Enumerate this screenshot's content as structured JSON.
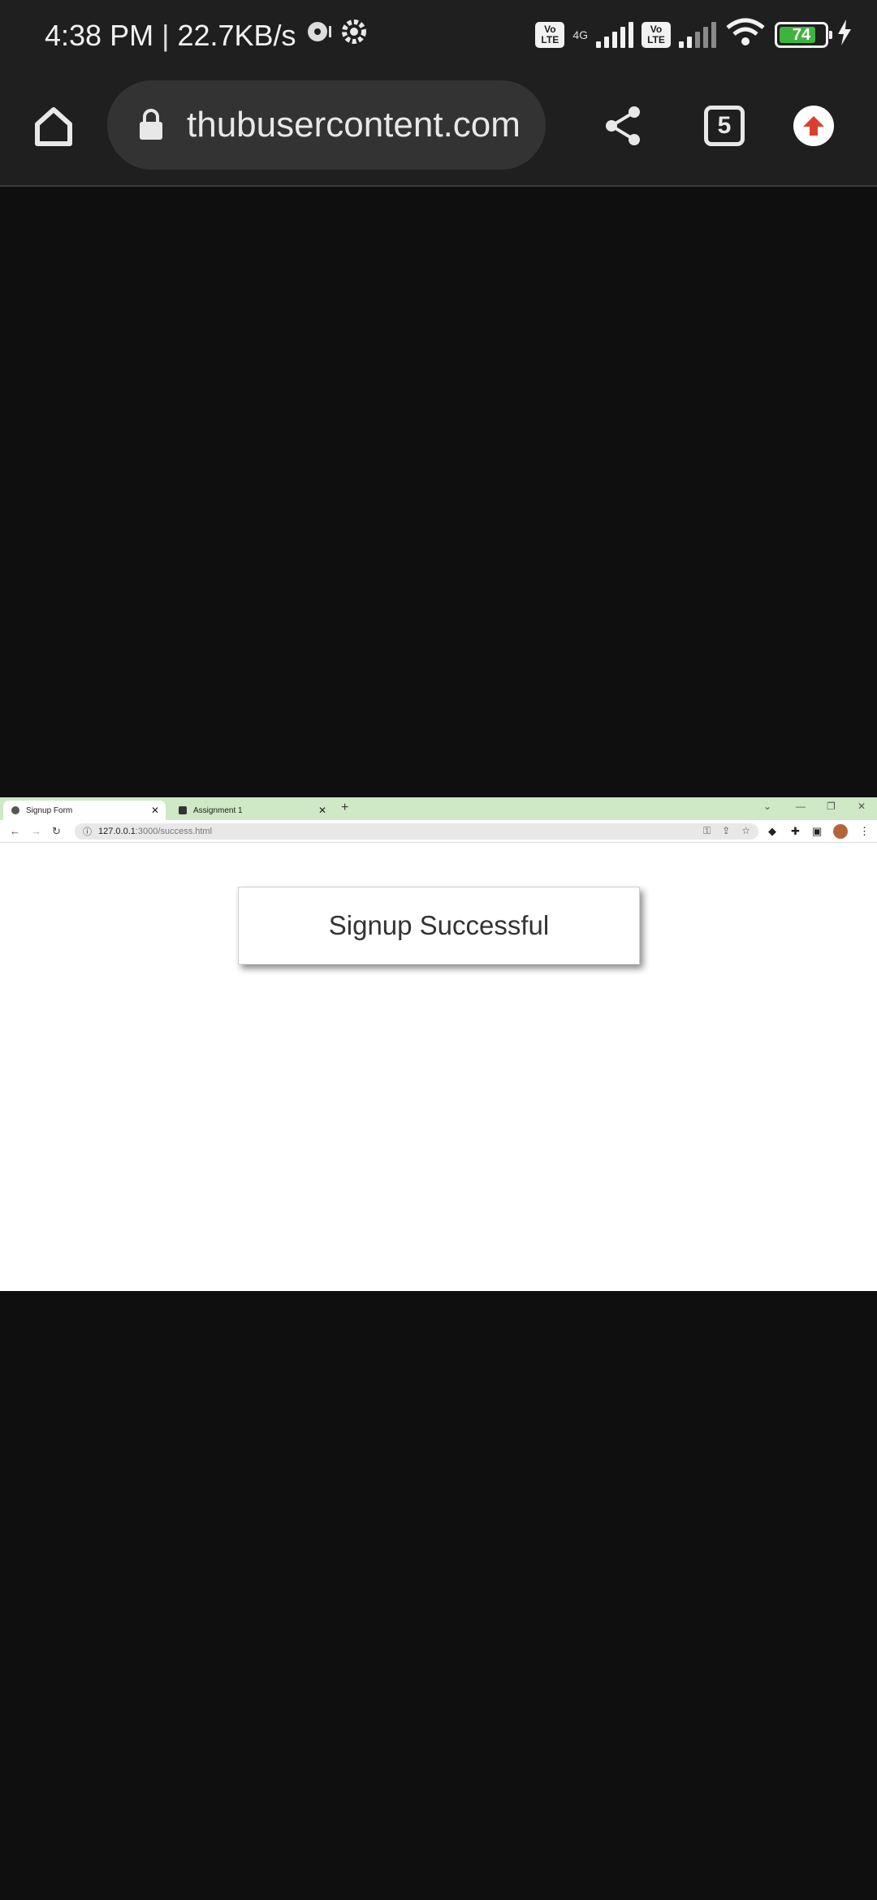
{
  "status_bar": {
    "time": "4:38 PM",
    "separator": "|",
    "net_speed": "22.7KB/s",
    "volte_label": "Vo LTE",
    "network_type": "4G",
    "battery_level": "74",
    "battery_color": "#3fb33f"
  },
  "browser": {
    "url": "thubusercontent.com",
    "tab_count": "5",
    "icons": [
      "home-icon",
      "lock-icon",
      "share-icon",
      "tabs-icon",
      "upload-icon"
    ]
  },
  "embedded_screenshot": {
    "tabs": [
      {
        "label": "Signup Form",
        "active": true
      },
      {
        "label": "Assignment 1",
        "active": false
      }
    ],
    "address": {
      "host": "127.0.0.1",
      "path": ":3000/success.html"
    },
    "card_title": "Signup Successful",
    "tabstrip_color": "#cfe8c5"
  }
}
